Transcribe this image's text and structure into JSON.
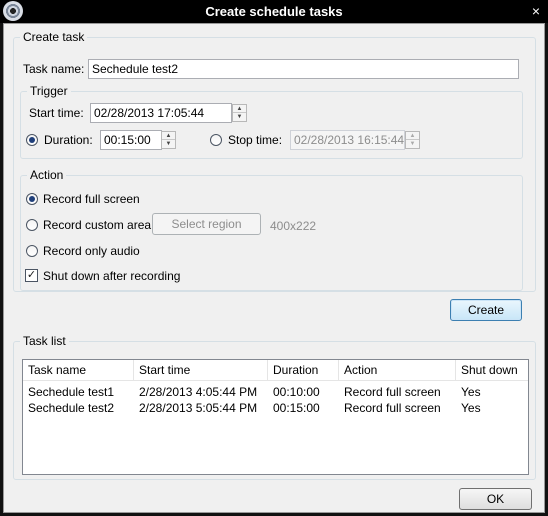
{
  "window": {
    "title": "Create schedule tasks",
    "close_glyph": "×"
  },
  "create_task": {
    "group_label": "Create task",
    "task_name_label": "Task name:",
    "task_name_value": "Sechedule test2",
    "trigger": {
      "group_label": "Trigger",
      "start_time_label": "Start time:",
      "start_time_value": "02/28/2013 17:05:44",
      "duration_label": "Duration:",
      "duration_value": "00:15:00",
      "duration_selected": true,
      "stop_time_label": "Stop time:",
      "stop_time_value": "02/28/2013 16:15:44",
      "stop_time_selected": false
    },
    "action": {
      "group_label": "Action",
      "options": [
        {
          "label": "Record full screen",
          "selected": true
        },
        {
          "label": "Record custom area",
          "selected": false
        },
        {
          "label": "Record only audio",
          "selected": false
        }
      ],
      "select_region_label": "Select region",
      "region_size": "400x222",
      "shutdown_label": "Shut down after recording",
      "shutdown_checked": true
    },
    "create_button": "Create"
  },
  "task_list": {
    "group_label": "Task list",
    "columns": [
      "Task name",
      "Start time",
      "Duration",
      "Action",
      "Shut down"
    ],
    "rows": [
      [
        "Sechedule test1",
        "2/28/2013 4:05:44 PM",
        "00:10:00",
        "Record full screen",
        "Yes"
      ],
      [
        "Sechedule test2",
        "2/28/2013 5:05:44 PM",
        "00:15:00",
        "Record full screen",
        "Yes"
      ]
    ]
  },
  "ok_button": "OK",
  "icons": {
    "app": "film-reel-icon",
    "close": "close-icon",
    "spin_up": "arrow-up-icon",
    "spin_down": "arrow-down-icon",
    "check": "checkmark-icon"
  }
}
